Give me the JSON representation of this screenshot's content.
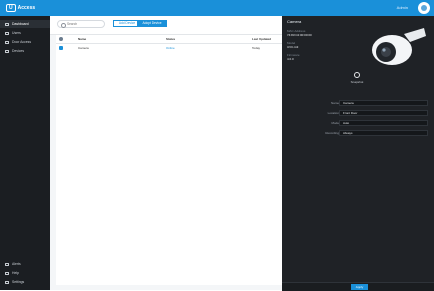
{
  "header": {
    "logo_text": "Access",
    "user_name": "Admin"
  },
  "sidebar": {
    "items": [
      {
        "label": "Dashboard"
      },
      {
        "label": "Users"
      },
      {
        "label": "Door Access"
      },
      {
        "label": "Devices"
      }
    ],
    "bottom": [
      {
        "label": "Alerts"
      },
      {
        "label": "Help"
      },
      {
        "label": "Settings"
      }
    ]
  },
  "main": {
    "search_placeholder": "Search",
    "filter_label": "Add Device",
    "primary_label": "Adopt Device",
    "columns": [
      "Name",
      "Status",
      "Last Updated"
    ],
    "rows": [
      {
        "name": "Camera",
        "status": "Online",
        "updated": "Today"
      }
    ]
  },
  "panel": {
    "title": "Camera",
    "meta": [
      {
        "label": "MAC Address",
        "value": "74:83:C2:00:00:00"
      },
      {
        "label": "Model",
        "value": "UVC-G3"
      },
      {
        "label": "Firmware",
        "value": "4.0.0"
      }
    ],
    "capture_label": "Snapshot",
    "fields": [
      {
        "label": "Name",
        "value": "Camera"
      },
      {
        "label": "Location",
        "value": "Front Door"
      },
      {
        "label": "Mode",
        "value": "Auto"
      },
      {
        "label": "Recording",
        "value": "Always"
      }
    ],
    "apply_label": "Apply"
  }
}
